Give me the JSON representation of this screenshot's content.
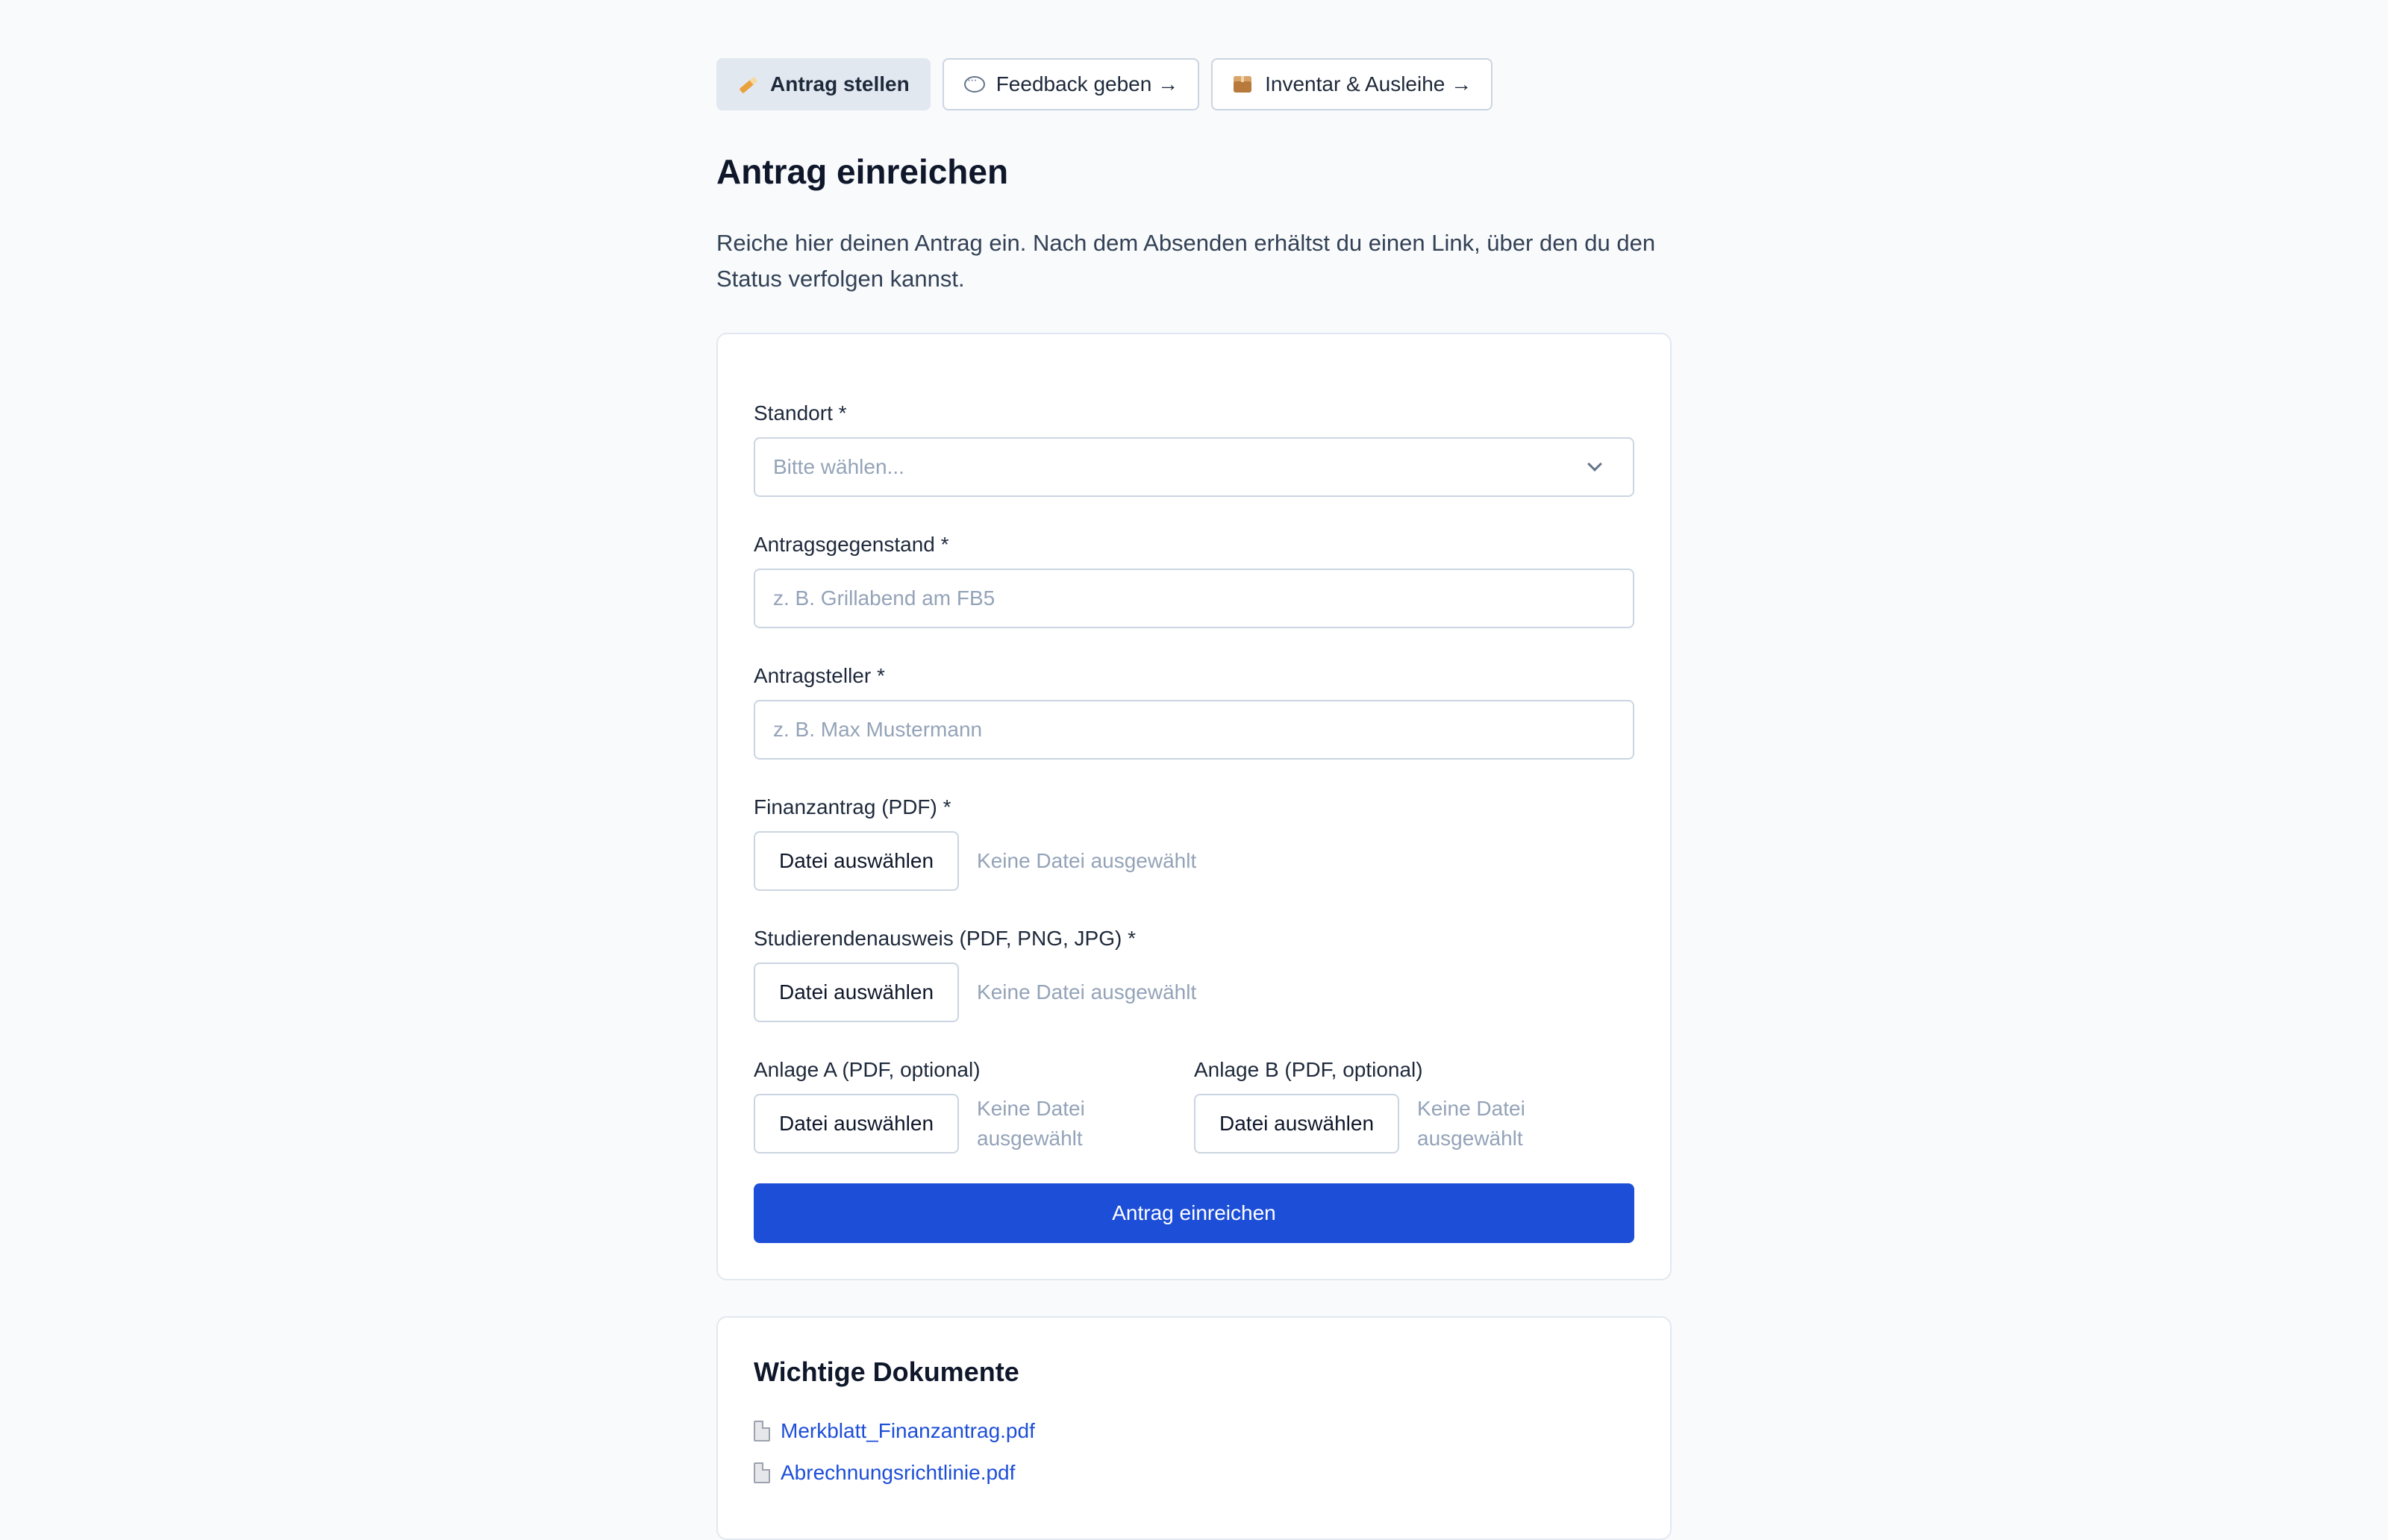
{
  "nav": {
    "items": [
      {
        "label": "Antrag stellen",
        "icon": "pencil-icon",
        "active": true
      },
      {
        "label": "Feedback geben →",
        "icon": "speech-bubble-icon",
        "active": false
      },
      {
        "label": "Inventar & Ausleihe →",
        "icon": "package-icon",
        "active": false
      }
    ]
  },
  "page": {
    "title": "Antrag einreichen",
    "intro": "Reiche hier deinen Antrag ein. Nach dem Absenden erhältst du einen Link, über den du den Status verfolgen kannst."
  },
  "form": {
    "standort": {
      "label": "Standort *",
      "placeholder": "Bitte wählen..."
    },
    "gegenstand": {
      "label": "Antragsgegenstand *",
      "placeholder": "z. B. Grillabend am FB5"
    },
    "antragsteller": {
      "label": "Antragsteller *",
      "placeholder": "z. B. Max Mustermann"
    },
    "finanzantrag": {
      "label": "Finanzantrag (PDF) *",
      "button": "Datei auswählen",
      "status": "Keine Datei ausgewählt"
    },
    "ausweis": {
      "label": "Studierendenausweis (PDF, PNG, JPG) *",
      "button": "Datei auswählen",
      "status": "Keine Datei ausgewählt"
    },
    "anlage_a": {
      "label": "Anlage A (PDF, optional)",
      "button": "Datei auswählen",
      "status": "Keine Datei ausgewählt"
    },
    "anlage_b": {
      "label": "Anlage B (PDF, optional)",
      "button": "Datei auswählen",
      "status": "Keine Datei ausgewählt"
    },
    "submit_label": "Antrag einreichen"
  },
  "documents": {
    "title": "Wichtige Dokumente",
    "items": [
      {
        "name": "Merkblatt_Finanzantrag.pdf",
        "icon": "document-icon"
      },
      {
        "name": "Abrechnungsrichtlinie.pdf",
        "icon": "document-icon"
      }
    ]
  },
  "colors": {
    "primary": "#1d4ed8",
    "background": "#f8fafc",
    "border": "#cbd5e1",
    "active_tab": "#e2e8f0"
  }
}
